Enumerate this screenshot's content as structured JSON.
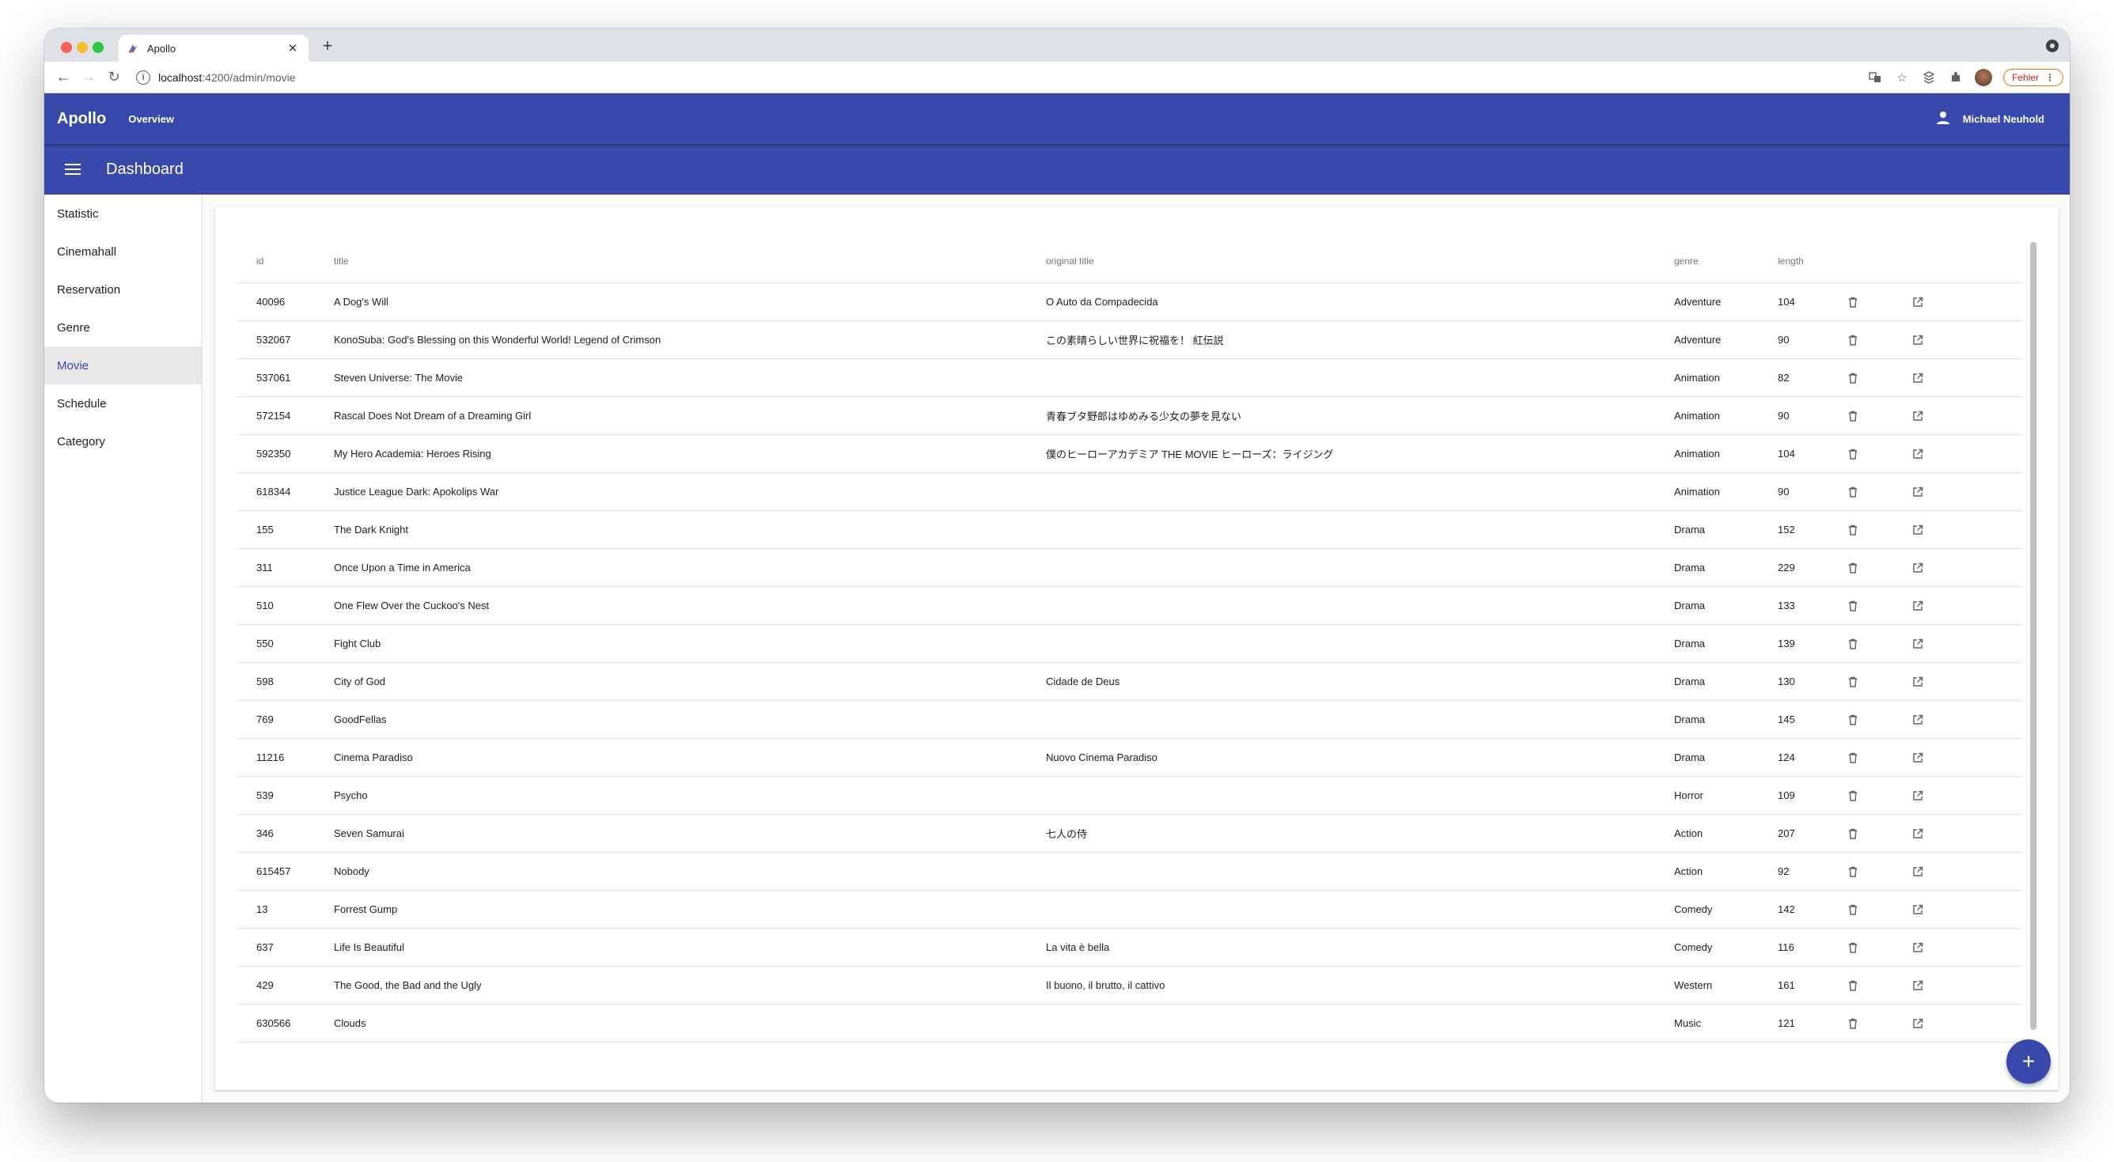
{
  "browser": {
    "tab_title": "Apollo",
    "url_host": "localhost",
    "url_path": ":4200/admin/movie",
    "error_pill": "Fehler"
  },
  "app": {
    "brand": "Apollo",
    "nav_overview": "Overview",
    "user_name": "Michael Neuhold",
    "page_title": "Dashboard",
    "accent_color": "#3949ab"
  },
  "sidebar": {
    "items": [
      {
        "label": "Statistic"
      },
      {
        "label": "Cinemahall"
      },
      {
        "label": "Reservation"
      },
      {
        "label": "Genre"
      },
      {
        "label": "Movie"
      },
      {
        "label": "Schedule"
      },
      {
        "label": "Category"
      }
    ],
    "active": "Movie"
  },
  "table": {
    "headers": {
      "id": "id",
      "title": "title",
      "original_title": "original title",
      "genre": "genre",
      "length": "length"
    },
    "rows": [
      {
        "id": "40096",
        "title": "A Dog's Will",
        "original_title": "O Auto da Compadecida",
        "genre": "Adventure",
        "length": "104"
      },
      {
        "id": "532067",
        "title": "KonoSuba: God's Blessing on this Wonderful World! Legend of Crimson",
        "original_title": "この素晴らしい世界に祝福を！ 紅伝説",
        "genre": "Adventure",
        "length": "90"
      },
      {
        "id": "537061",
        "title": "Steven Universe: The Movie",
        "original_title": "",
        "genre": "Animation",
        "length": "82"
      },
      {
        "id": "572154",
        "title": "Rascal Does Not Dream of a Dreaming Girl",
        "original_title": "青春ブタ野郎はゆめみる少女の夢を見ない",
        "genre": "Animation",
        "length": "90"
      },
      {
        "id": "592350",
        "title": "My Hero Academia: Heroes Rising",
        "original_title": "僕のヒーローアカデミア THE MOVIE ヒーローズ：ライジング",
        "genre": "Animation",
        "length": "104"
      },
      {
        "id": "618344",
        "title": "Justice League Dark: Apokolips War",
        "original_title": "",
        "genre": "Animation",
        "length": "90"
      },
      {
        "id": "155",
        "title": "The Dark Knight",
        "original_title": "",
        "genre": "Drama",
        "length": "152"
      },
      {
        "id": "311",
        "title": "Once Upon a Time in America",
        "original_title": "",
        "genre": "Drama",
        "length": "229"
      },
      {
        "id": "510",
        "title": "One Flew Over the Cuckoo's Nest",
        "original_title": "",
        "genre": "Drama",
        "length": "133"
      },
      {
        "id": "550",
        "title": "Fight Club",
        "original_title": "",
        "genre": "Drama",
        "length": "139"
      },
      {
        "id": "598",
        "title": "City of God",
        "original_title": "Cidade de Deus",
        "genre": "Drama",
        "length": "130"
      },
      {
        "id": "769",
        "title": "GoodFellas",
        "original_title": "",
        "genre": "Drama",
        "length": "145"
      },
      {
        "id": "11216",
        "title": "Cinema Paradiso",
        "original_title": "Nuovo Cinema Paradiso",
        "genre": "Drama",
        "length": "124"
      },
      {
        "id": "539",
        "title": "Psycho",
        "original_title": "",
        "genre": "Horror",
        "length": "109"
      },
      {
        "id": "346",
        "title": "Seven Samurai",
        "original_title": "七人の侍",
        "genre": "Action",
        "length": "207"
      },
      {
        "id": "615457",
        "title": "Nobody",
        "original_title": "",
        "genre": "Action",
        "length": "92"
      },
      {
        "id": "13",
        "title": "Forrest Gump",
        "original_title": "",
        "genre": "Comedy",
        "length": "142"
      },
      {
        "id": "637",
        "title": "Life Is Beautiful",
        "original_title": "La vita è bella",
        "genre": "Comedy",
        "length": "116"
      },
      {
        "id": "429",
        "title": "The Good, the Bad and the Ugly",
        "original_title": "Il buono, il brutto, il cattivo",
        "genre": "Western",
        "length": "161"
      },
      {
        "id": "630566",
        "title": "Clouds",
        "original_title": "",
        "genre": "Music",
        "length": "121"
      }
    ]
  },
  "icons": {
    "delete": "trash-icon",
    "edit": "open-in-new-icon",
    "fab": "add-icon"
  }
}
